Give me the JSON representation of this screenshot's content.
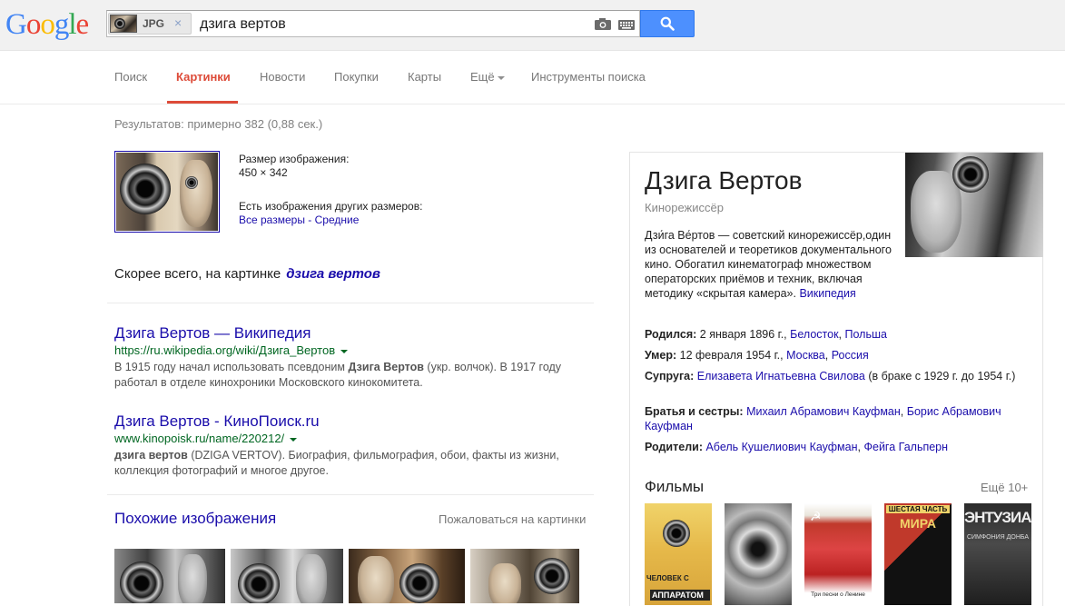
{
  "header": {
    "logo_letters": [
      {
        "ch": "G",
        "color": "#4285f4"
      },
      {
        "ch": "o",
        "color": "#ea4335"
      },
      {
        "ch": "o",
        "color": "#fbbc05"
      },
      {
        "ch": "g",
        "color": "#4285f4"
      },
      {
        "ch": "l",
        "color": "#34a853"
      },
      {
        "ch": "e",
        "color": "#ea4335"
      }
    ],
    "chip_label": "JPG",
    "chip_close": "×",
    "query": "дзига вертов",
    "icons": [
      "camera-icon",
      "keyboard-icon",
      "search-icon"
    ]
  },
  "nav": {
    "items": [
      {
        "label": "Поиск"
      },
      {
        "label": "Картинки",
        "active": true
      },
      {
        "label": "Новости"
      },
      {
        "label": "Покупки"
      },
      {
        "label": "Карты"
      },
      {
        "label": "Ещё"
      },
      {
        "label": "Инструменты поиска"
      }
    ]
  },
  "results_count": "Результатов: примерно 382 (0,88 сек.)",
  "image_info": {
    "size_label": "Размер изображения:",
    "size_value": "450 × 342",
    "other_sizes_label": "Есть изображения других размеров:",
    "all_sizes": "Все размеры",
    "separator": " - ",
    "medium": "Средние"
  },
  "best_guess": {
    "prefix": "Скорее всего, на картинке",
    "term": "дзига вертов"
  },
  "results": [
    {
      "title": "Дзига Вертов — Википедия",
      "url": "https://ru.wikipedia.org/wiki/Дзига_Вертов",
      "snippet_pre": "В 1915 году начал использовать псевдоним ",
      "snippet_bold": "Дзига Вертов",
      "snippet_post": " (укр. волчок). В 1917 году работал в отделе кинохроники Московского кинокомитета."
    },
    {
      "title": "Дзига Вертов - КиноПоиск.ru",
      "url": "www.kinopoisk.ru/name/220212/",
      "snippet_pre": "",
      "snippet_bold": "дзига вертов",
      "snippet_post": " (DZIGA VERTOV). Биография, фильмография, обои, факты из жизни, коллекция фотографий и многое другое."
    }
  ],
  "similar": {
    "title": "Похожие изображения",
    "report": "Пожаловаться на картинки"
  },
  "knowledge_panel": {
    "title": "Дзига Вертов",
    "subtitle": "Кинорежиссёр",
    "description": "Дзи́га Ве́ртов — советский кинорежиссёр,один из основателей и теоретиков документального кино. Обогатил кинематограф множеством операторских приёмов и техник, включая методику «скрытая камера».",
    "source": "Википедия",
    "born_label": "Родился:",
    "born_value": "2 января 1896 г.,",
    "born_place1": "Белосток",
    "born_place2": "Польша",
    "died_label": "Умер:",
    "died_value": "12 февраля 1954 г.,",
    "died_place1": "Москва",
    "died_place2": "Россия",
    "spouse_label": "Супруга:",
    "spouse_value": "Елизавета Игнатьевна Свилова",
    "spouse_note": "(в браке с 1929 г. до 1954 г.)",
    "siblings_label": "Братья и сестры:",
    "sibling1": "Михаил Абрамович Кауфман",
    "sibling2": "Борис Абрамович Кауфман",
    "parents_label": "Родители:",
    "parent1": "Абель Кушелиович Кауфман",
    "parent2": "Фейга Гальперн",
    "comma": ",",
    "films_title": "Фильмы",
    "films_more": "Ещё 10+",
    "film_posters": [
      {
        "text1": "ЧЕЛОВЕК С",
        "text2": "АППАРАТОМ"
      },
      {
        "text1": "",
        "text2": ""
      },
      {
        "text1": "Три песни о Ленине",
        "text2": ""
      },
      {
        "text1": "ШЕСТАЯ ЧАСТЬ",
        "text2": "МИРА"
      },
      {
        "text1": "ЭНТУЗИАЗ",
        "text2": "СИМФОНИЯ ДОНБА"
      }
    ]
  }
}
